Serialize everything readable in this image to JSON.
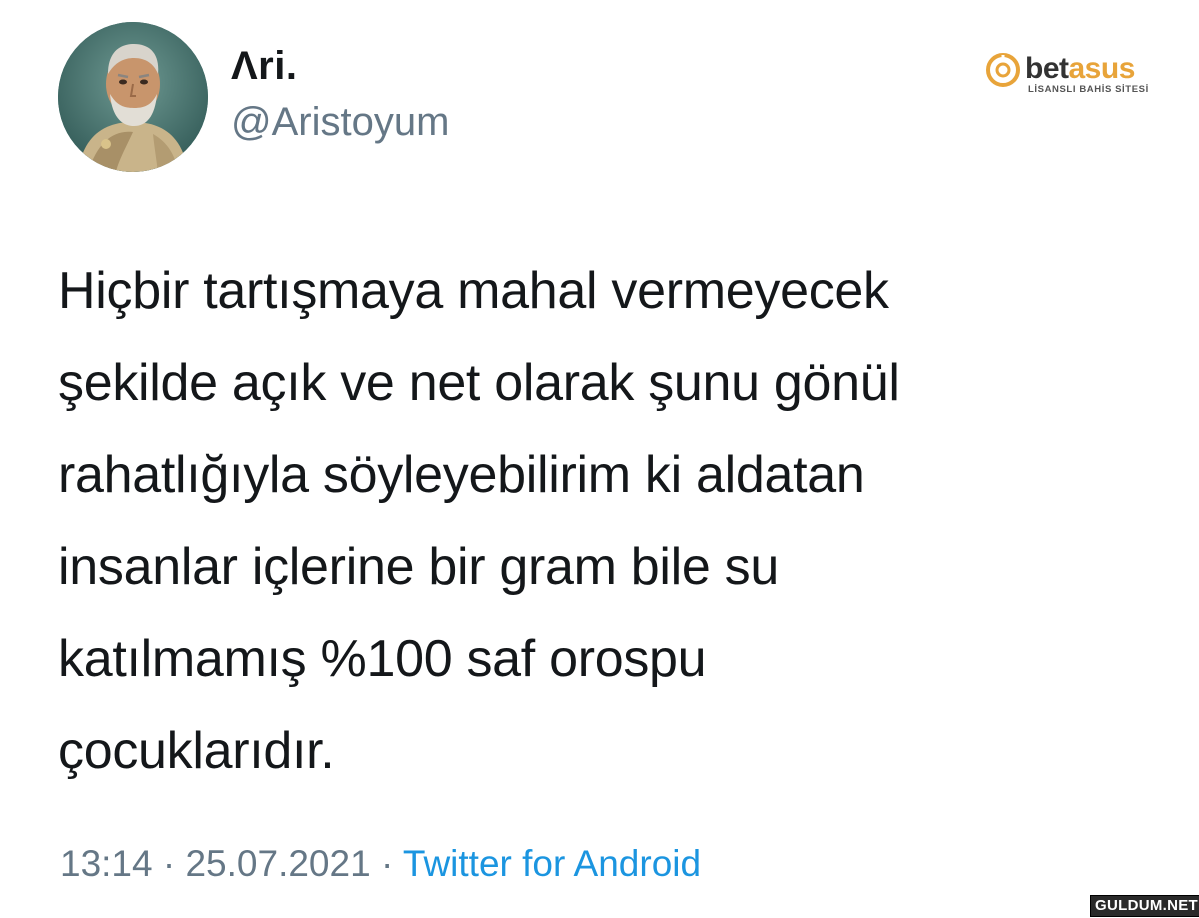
{
  "user": {
    "display_name": "Λri.",
    "handle": "@Aristoyum",
    "avatar_icon": "philosopher-bust-avatar"
  },
  "sponsor": {
    "brand_dark": "bet",
    "brand_accent": "asus",
    "tagline": "LİSANSLI BAHİS SİTESİ",
    "icon": "target-ring-icon",
    "accent_color": "#e8a43a"
  },
  "tweet": {
    "lines": [
      "Hiçbir tartışmaya mahal vermeyecek",
      "şekilde açık ve net olarak şunu gönül",
      "rahatlığıyla söyleyebilirim ki aldatan",
      "insanlar içlerine bir gram bile su",
      "katılmamış %100 saf orospu",
      "çocuklarıdır."
    ]
  },
  "meta": {
    "time": "13:14",
    "separator": " · ",
    "date": "25.07.2021",
    "source": "Twitter for Android",
    "source_color": "#1b95e0"
  },
  "watermark": {
    "text": "GULDUM.NET"
  }
}
